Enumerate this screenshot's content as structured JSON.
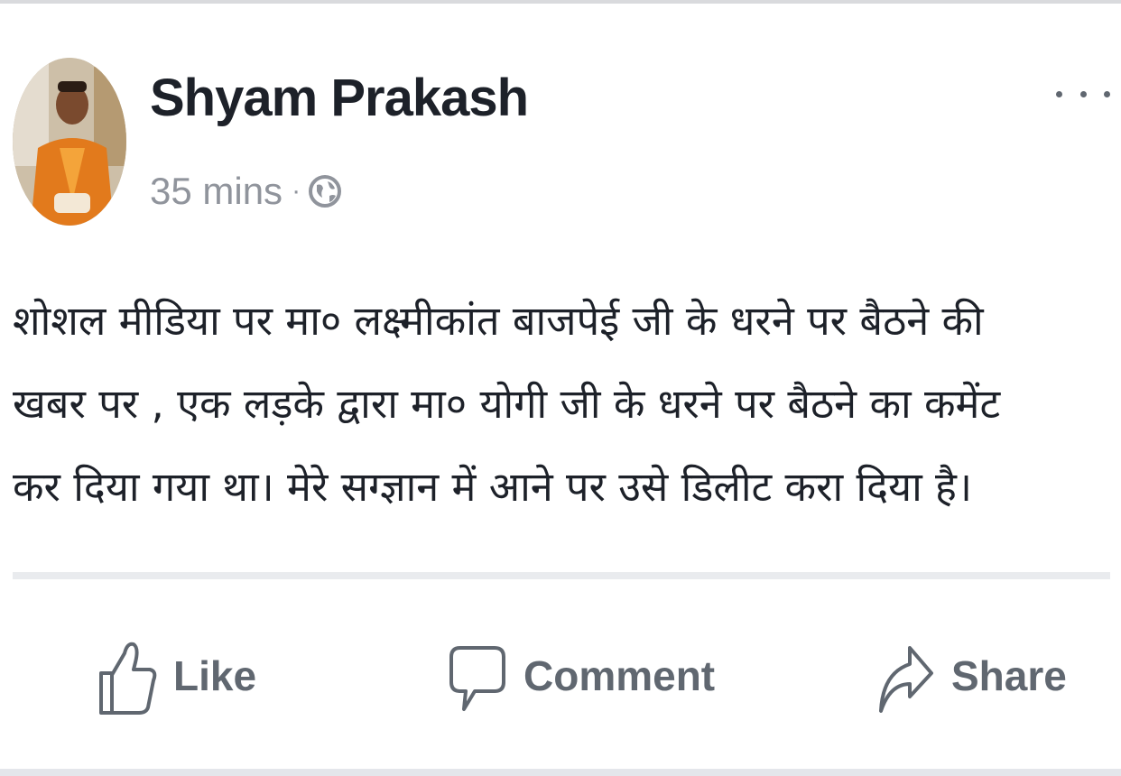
{
  "post": {
    "author": "Shyam Prakash",
    "timestamp": "35 mins",
    "separator": "·",
    "privacy_icon": "globe-icon",
    "menu_icon": "more-options-icon",
    "text_lines": [
      "शोशल मीडिया पर मा० लक्ष्मीकांत बाजपेई जी के धरने पर बैठने की",
      "खबर पर , एक लड़के   द्वारा मा० योगी जी के धरने पर बैठने का कमेंट",
      "कर दिया गया था। मेरे सग्ज्ञान में आने पर उसे डिलीट करा दिया है।"
    ]
  },
  "actions": {
    "like_label": "Like",
    "comment_label": "Comment",
    "share_label": "Share"
  },
  "colors": {
    "text": "#1d2129",
    "meta": "#90949c",
    "action": "#606770",
    "divider": "#e9ebee"
  }
}
